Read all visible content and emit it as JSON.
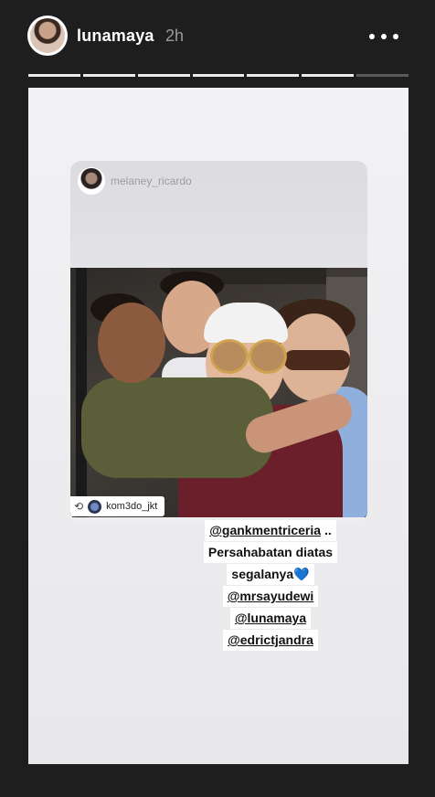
{
  "header": {
    "username": "lunamaya",
    "time_ago": "2h",
    "progress": {
      "segments": 7,
      "completed": 6
    }
  },
  "repost": {
    "username": "melaney_ricardo",
    "photo_credit": "kom3do_jkt"
  },
  "caption": {
    "lines": [
      {
        "text": "@gankmentriceria",
        "suffix": " .."
      },
      {
        "text": "Persahabatan diatas"
      },
      {
        "text": "segalanya",
        "suffix": "💙"
      },
      {
        "text": "@mrsayudewi"
      },
      {
        "text": "@lunamaya"
      },
      {
        "text": "@edrictjandra"
      }
    ]
  },
  "colors": {
    "background": "#1e1e1e",
    "heart": "#2f7fe8"
  },
  "icons": {
    "more": "more-dots-icon",
    "repost": "repost-loop-icon"
  }
}
